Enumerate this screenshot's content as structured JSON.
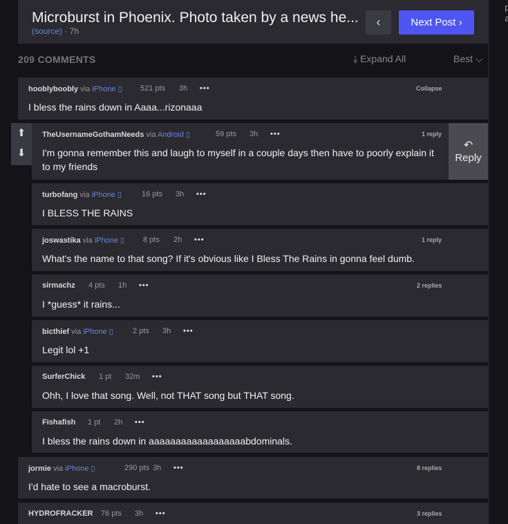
{
  "post": {
    "title": "Microburst in Phoenix. Photo taken by a news he...",
    "source": "(source)",
    "age": " · 7h",
    "prev_icon": "‹",
    "next_label": "Next Post ›"
  },
  "comments_header": {
    "count": "209 COMMENTS",
    "expand_all": "⤓ Expand All",
    "sort": "Best ⌵"
  },
  "side_text": [
    "p",
    "a"
  ],
  "vote": {
    "up": "⬆",
    "down": "⬇"
  },
  "reply_button": {
    "icon": "↶",
    "label": "Reply"
  },
  "comments": [
    {
      "user": "hooblyboobly",
      "via": " via ",
      "client": "iPhone ▯",
      "pts": "521 pts",
      "age": "3h",
      "dots": "•••",
      "right": "Collapse",
      "text": "I bless the rains down in Aaaa...rizonaaa"
    },
    {
      "user": "TheUsernameGothamNeeds",
      "via": " via ",
      "client": "Android ▯",
      "pts": "59 pts",
      "age": "3h",
      "dots": "•••",
      "right": "1 reply",
      "text": "I'm gonna remember this and laugh to myself in a couple days then have to poorly explain it to my friends"
    },
    {
      "user": "turbofang",
      "via": " via ",
      "client": "iPhone ▯",
      "pts": "16 pts",
      "age": "3h",
      "dots": "•••",
      "right": "",
      "text": "I BLESS THE RAINS"
    },
    {
      "user": "joswastika",
      "via": " via ",
      "client": "iPhone ▯",
      "pts": "8 pts",
      "age": "2h",
      "dots": "•••",
      "right": "1 reply",
      "text": "What's the name to that song? If it's obvious like I Bless The Rains in gonna feel dumb."
    },
    {
      "user": "sirmachz",
      "via": "",
      "client": "",
      "pts": "4 pts",
      "age": "1h",
      "dots": "•••",
      "right": "2 replies",
      "text": "I *guess* it rains..."
    },
    {
      "user": "bicthief",
      "via": " via ",
      "client": "iPhone ▯",
      "pts": "2 pts",
      "age": "3h",
      "dots": "•••",
      "right": "",
      "text": "Legit lol +1"
    },
    {
      "user": "SurferChick",
      "via": "",
      "client": "",
      "pts": "1 pt",
      "age": "32m",
      "dots": "•••",
      "right": "",
      "text": "Ohh, I love that song. Well, not THAT song but THAT song."
    },
    {
      "user": "Fishafish",
      "via": "",
      "client": "",
      "pts": "1 pt",
      "age": "2h",
      "dots": "•••",
      "right": "",
      "text": "I bless the rains down in aaaaaaaaaaaaaaaaaabdominals."
    },
    {
      "user": "jormie",
      "via": " via ",
      "client": "iPhone ▯",
      "pts": "290 pts",
      "age": "3h",
      "dots": "•••",
      "right": "8 replies",
      "text": "I'd hate to see a macroburst."
    },
    {
      "user": "HYDROFRACKER",
      "via": "",
      "client": "",
      "pts": "76 pts",
      "age": "3h",
      "dots": "•••",
      "right": "3 replies",
      "text": ""
    }
  ]
}
